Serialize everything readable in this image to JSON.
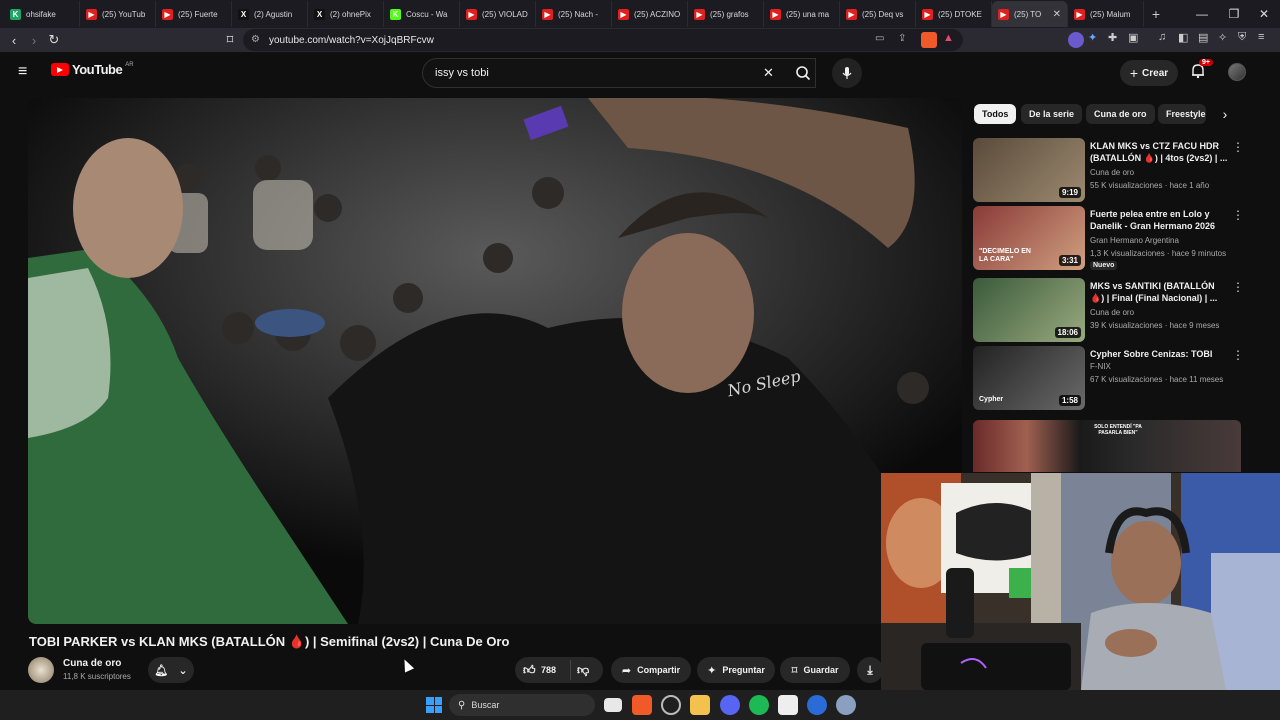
{
  "browser": {
    "tabs": [
      {
        "label": "ohsifake",
        "color": "#1fa463",
        "glyph": "K"
      },
      {
        "label": "(25) YouTub",
        "color": "#e01f1f",
        "glyph": "▶"
      },
      {
        "label": "(25) Fuerte",
        "color": "#e01f1f",
        "glyph": "▶"
      },
      {
        "label": "(2) Agustin",
        "color": "#111111",
        "glyph": "X"
      },
      {
        "label": "(2) ohnePix",
        "color": "#111111",
        "glyph": "X"
      },
      {
        "label": "Coscu - Wa",
        "color": "#53fc18",
        "glyph": "K"
      },
      {
        "label": "(25) VIOLAD",
        "color": "#e01f1f",
        "glyph": "▶"
      },
      {
        "label": "(25) Nach -",
        "color": "#e01f1f",
        "glyph": "▶"
      },
      {
        "label": "(25) ACZINO",
        "color": "#e01f1f",
        "glyph": "▶"
      },
      {
        "label": "(25) grafos",
        "color": "#e01f1f",
        "glyph": "▶"
      },
      {
        "label": "(25) una ma",
        "color": "#e01f1f",
        "glyph": "▶"
      },
      {
        "label": "(25) Deq vs",
        "color": "#e01f1f",
        "glyph": "▶"
      },
      {
        "label": "(25) DTOKE",
        "color": "#e01f1f",
        "glyph": "▶"
      },
      {
        "label": "(25) TO",
        "color": "#e01f1f",
        "glyph": "▶",
        "active": true
      },
      {
        "label": "(25) Malum",
        "color": "#e01f1f",
        "glyph": "▶"
      }
    ],
    "url": "youtube.com/watch?v=XojJqBRFcvw"
  },
  "youtube": {
    "logo_text": "YouTube",
    "region": "AR",
    "search_value": "issy vs tobi",
    "create_label": "Crear",
    "notif_badge": "9+",
    "video_title": "TOBI PARKER vs KLAN MKS (BATALLÓN 🩸) | Semifinal (2vs2) | Cuna De Oro",
    "channel_name": "Cuna de oro",
    "channel_subs": "11,8 K suscriptores",
    "like_count": "788",
    "share_label": "Compartir",
    "ask_label": "Preguntar",
    "save_label": "Guardar",
    "chips": [
      "Todos",
      "De la serie",
      "Cuna de oro",
      "Freestyle"
    ],
    "recommendations": [
      {
        "title": "KLAN MKS vs CTZ FACU HDR (BATALLÓN 🩸) | 4tos (2vs2) | ...",
        "channel": "Cuna de oro",
        "meta": "55 K visualizaciones · hace 1 año",
        "duration": "9:19",
        "colors": [
          "#5a4a3a",
          "#9c8a70"
        ]
      },
      {
        "title": "Fuerte pelea entre en Lolo y Danelik - Gran Hermano 2026",
        "channel": "Gran Hermano Argentina",
        "meta": "1,3 K visualizaciones · hace 9 minutos",
        "duration": "3:31",
        "badge": "Nuevo",
        "caption": "\"DECIMELO EN LA CARA\"",
        "colors": [
          "#8a3a38",
          "#d0a080"
        ]
      },
      {
        "title": "MKS vs SANTIKI (BATALLÓN 🩸) | Final (Final Nacional) | ...",
        "channel": "Cuna de oro",
        "meta": "39 K visualizaciones · hace 9 meses",
        "duration": "18:06",
        "colors": [
          "#3a5a3a",
          "#9aaa80"
        ]
      },
      {
        "title": "Cypher Sobre Cenizas: TOBI",
        "channel": "F-NIX",
        "meta": "67 K visualizaciones · hace 11 meses",
        "duration": "1:58",
        "caption": "Cypher",
        "colors": [
          "#222222",
          "#6a6a6a"
        ]
      }
    ],
    "partial_thumb_text": "SOLO ENTENDÍ \"PA PASARLA BIEN\""
  },
  "taskbar": {
    "search_placeholder": "Buscar"
  },
  "colors": {
    "accent": "#ff0000",
    "background": "#0f0f0f",
    "chip": "#272727"
  }
}
